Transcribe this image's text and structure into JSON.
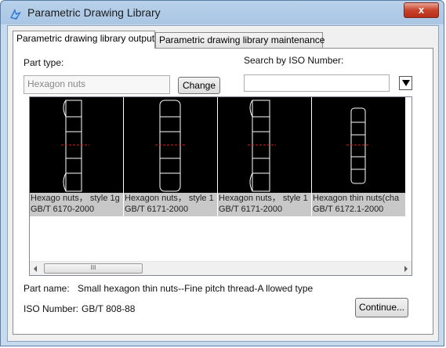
{
  "window": {
    "title": "Parametric Drawing Library",
    "close_label": "x"
  },
  "tabs": [
    {
      "label": "Parametric drawing library output",
      "active": true
    },
    {
      "label": "Parametric drawing library maintenance",
      "active": false
    }
  ],
  "part_type": {
    "label": "Part type:",
    "value": "Hexagon nuts",
    "change_label": "Change"
  },
  "search": {
    "label": "Search by ISO Number:",
    "value": ""
  },
  "gallery": {
    "items": [
      {
        "line1": "Hexago nuts， style 1g",
        "line2": "GB/T 6170-2000"
      },
      {
        "line1": "Hexagon nuts， style 1",
        "line2": "GB/T 6171-2000"
      },
      {
        "line1": "Hexagon nuts， style 1",
        "line2": "GB/T 6171-2000"
      },
      {
        "line1": "Hexagon thin nuts(cha",
        "line2": "GB/T 6172.1-2000"
      }
    ],
    "scroll_grip": "III"
  },
  "part_name": {
    "label": "Part name:",
    "value": "Small hexagon thin nuts--Fine pitch thread-A llowed type"
  },
  "iso_number": {
    "label": "ISO Number:",
    "value": "GB/T 808-88"
  },
  "continue_label": "Continue..."
}
